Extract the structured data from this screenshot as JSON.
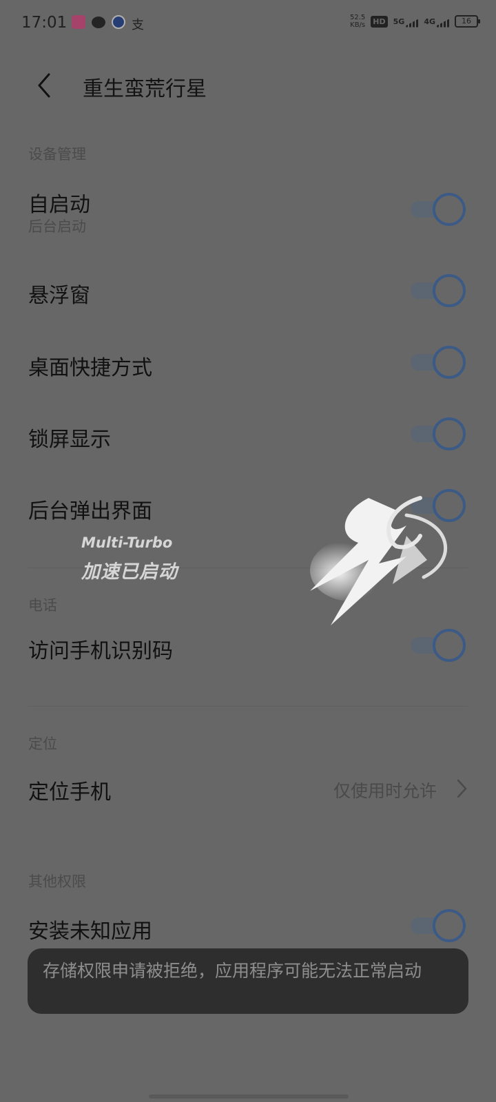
{
  "status_bar": {
    "time": "17:01",
    "notification_icons": [
      "app-icon",
      "chat-icon",
      "robot-icon",
      "pay-icon"
    ],
    "pay_glyph": "支",
    "net_speed": "52.5",
    "net_unit": "KB/s",
    "hd": "HD",
    "sim1": "5G",
    "sim2": "4G",
    "battery": "16"
  },
  "header": {
    "title": "重生蛮荒行星"
  },
  "sections": {
    "device": {
      "label": "设备管理"
    },
    "phone": {
      "label": "电话"
    },
    "location": {
      "label": "定位"
    },
    "other": {
      "label": "其他权限"
    }
  },
  "rows": {
    "autostart": {
      "title": "自启动",
      "subtitle": "后台启动",
      "enabled": true
    },
    "floating": {
      "title": "悬浮窗",
      "enabled": true
    },
    "shortcut": {
      "title": "桌面快捷方式",
      "enabled": true
    },
    "lockscreen": {
      "title": "锁屏显示",
      "enabled": true
    },
    "bg_popup": {
      "title": "后台弹出界面",
      "enabled": true
    },
    "imei": {
      "title": "访问手机识别码",
      "enabled": true
    },
    "locate": {
      "title": "定位手机",
      "value": "仅使用时允许"
    },
    "unknown_apps": {
      "title": "安装未知应用",
      "enabled": true
    }
  },
  "overlay": {
    "turbo_en": "Multi-Turbo",
    "turbo_cn": "加速已启动"
  },
  "toast": {
    "message": "存储权限申请被拒绝，应用程序可能无法正常启动"
  },
  "colors": {
    "background": "#676767",
    "toggle_accent": "#3c5a86",
    "toast_bg": "#2e2e2e"
  }
}
